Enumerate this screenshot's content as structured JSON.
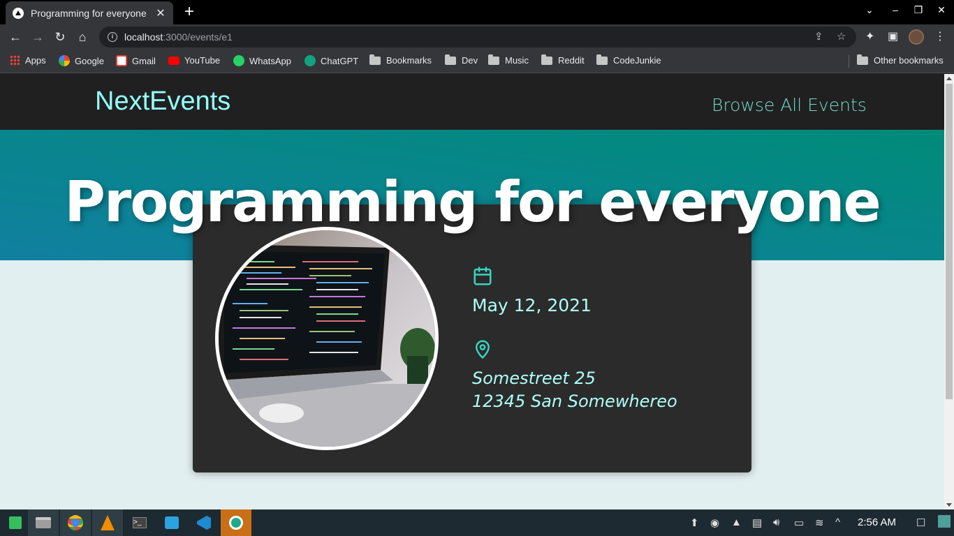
{
  "browser": {
    "tab_title": "Programming for everyone",
    "url_host": "localhost",
    "url_path": ":3000/events/e1",
    "bookmarks": [
      {
        "label": "Apps",
        "icon": "apps-grid-icon"
      },
      {
        "label": "Google",
        "icon": "google-icon"
      },
      {
        "label": "Gmail",
        "icon": "gmail-icon"
      },
      {
        "label": "YouTube",
        "icon": "youtube-icon"
      },
      {
        "label": "WhatsApp",
        "icon": "whatsapp-icon"
      },
      {
        "label": "ChatGPT",
        "icon": "chatgpt-icon"
      },
      {
        "label": "Bookmarks",
        "icon": "folder-icon"
      },
      {
        "label": "Dev",
        "icon": "folder-icon"
      },
      {
        "label": "Music",
        "icon": "folder-icon"
      },
      {
        "label": "Reddit",
        "icon": "folder-icon"
      },
      {
        "label": "CodeJunkie",
        "icon": "folder-icon"
      }
    ],
    "other_bookmarks": "Other bookmarks"
  },
  "site": {
    "logo": "NextEvents",
    "nav_link": "Browse All Events"
  },
  "event": {
    "title": "Programming for everyone",
    "date": "May 12, 2021",
    "address_line1": "Somestreet 25",
    "address_line2": "12345 San Somewhereo",
    "image_alt": "laptop with code on screen"
  },
  "taskbar": {
    "time": "2:56 AM"
  },
  "colors": {
    "logo": "#94fdfd",
    "nav_link": "#74dacc",
    "hero_start": "#008b79",
    "hero_end": "#1180a0",
    "card_bg": "#2b2b2b",
    "accent": "#aefff8",
    "icon": "#38d4c0"
  }
}
